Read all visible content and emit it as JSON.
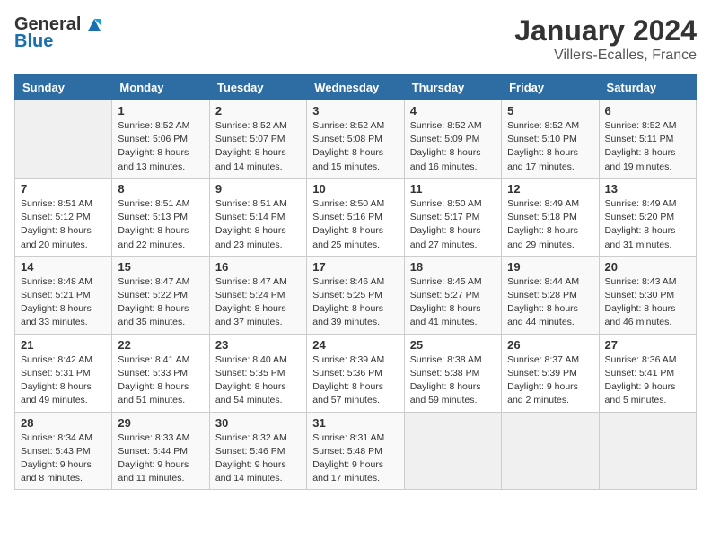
{
  "header": {
    "logo_general": "General",
    "logo_blue": "Blue",
    "month_year": "January 2024",
    "location": "Villers-Ecalles, France"
  },
  "days_of_week": [
    "Sunday",
    "Monday",
    "Tuesday",
    "Wednesday",
    "Thursday",
    "Friday",
    "Saturday"
  ],
  "weeks": [
    [
      {
        "day": "",
        "sunrise": "",
        "sunset": "",
        "daylight": ""
      },
      {
        "day": "1",
        "sunrise": "Sunrise: 8:52 AM",
        "sunset": "Sunset: 5:06 PM",
        "daylight": "Daylight: 8 hours and 13 minutes."
      },
      {
        "day": "2",
        "sunrise": "Sunrise: 8:52 AM",
        "sunset": "Sunset: 5:07 PM",
        "daylight": "Daylight: 8 hours and 14 minutes."
      },
      {
        "day": "3",
        "sunrise": "Sunrise: 8:52 AM",
        "sunset": "Sunset: 5:08 PM",
        "daylight": "Daylight: 8 hours and 15 minutes."
      },
      {
        "day": "4",
        "sunrise": "Sunrise: 8:52 AM",
        "sunset": "Sunset: 5:09 PM",
        "daylight": "Daylight: 8 hours and 16 minutes."
      },
      {
        "day": "5",
        "sunrise": "Sunrise: 8:52 AM",
        "sunset": "Sunset: 5:10 PM",
        "daylight": "Daylight: 8 hours and 17 minutes."
      },
      {
        "day": "6",
        "sunrise": "Sunrise: 8:52 AM",
        "sunset": "Sunset: 5:11 PM",
        "daylight": "Daylight: 8 hours and 19 minutes."
      }
    ],
    [
      {
        "day": "7",
        "sunrise": "Sunrise: 8:51 AM",
        "sunset": "Sunset: 5:12 PM",
        "daylight": "Daylight: 8 hours and 20 minutes."
      },
      {
        "day": "8",
        "sunrise": "Sunrise: 8:51 AM",
        "sunset": "Sunset: 5:13 PM",
        "daylight": "Daylight: 8 hours and 22 minutes."
      },
      {
        "day": "9",
        "sunrise": "Sunrise: 8:51 AM",
        "sunset": "Sunset: 5:14 PM",
        "daylight": "Daylight: 8 hours and 23 minutes."
      },
      {
        "day": "10",
        "sunrise": "Sunrise: 8:50 AM",
        "sunset": "Sunset: 5:16 PM",
        "daylight": "Daylight: 8 hours and 25 minutes."
      },
      {
        "day": "11",
        "sunrise": "Sunrise: 8:50 AM",
        "sunset": "Sunset: 5:17 PM",
        "daylight": "Daylight: 8 hours and 27 minutes."
      },
      {
        "day": "12",
        "sunrise": "Sunrise: 8:49 AM",
        "sunset": "Sunset: 5:18 PM",
        "daylight": "Daylight: 8 hours and 29 minutes."
      },
      {
        "day": "13",
        "sunrise": "Sunrise: 8:49 AM",
        "sunset": "Sunset: 5:20 PM",
        "daylight": "Daylight: 8 hours and 31 minutes."
      }
    ],
    [
      {
        "day": "14",
        "sunrise": "Sunrise: 8:48 AM",
        "sunset": "Sunset: 5:21 PM",
        "daylight": "Daylight: 8 hours and 33 minutes."
      },
      {
        "day": "15",
        "sunrise": "Sunrise: 8:47 AM",
        "sunset": "Sunset: 5:22 PM",
        "daylight": "Daylight: 8 hours and 35 minutes."
      },
      {
        "day": "16",
        "sunrise": "Sunrise: 8:47 AM",
        "sunset": "Sunset: 5:24 PM",
        "daylight": "Daylight: 8 hours and 37 minutes."
      },
      {
        "day": "17",
        "sunrise": "Sunrise: 8:46 AM",
        "sunset": "Sunset: 5:25 PM",
        "daylight": "Daylight: 8 hours and 39 minutes."
      },
      {
        "day": "18",
        "sunrise": "Sunrise: 8:45 AM",
        "sunset": "Sunset: 5:27 PM",
        "daylight": "Daylight: 8 hours and 41 minutes."
      },
      {
        "day": "19",
        "sunrise": "Sunrise: 8:44 AM",
        "sunset": "Sunset: 5:28 PM",
        "daylight": "Daylight: 8 hours and 44 minutes."
      },
      {
        "day": "20",
        "sunrise": "Sunrise: 8:43 AM",
        "sunset": "Sunset: 5:30 PM",
        "daylight": "Daylight: 8 hours and 46 minutes."
      }
    ],
    [
      {
        "day": "21",
        "sunrise": "Sunrise: 8:42 AM",
        "sunset": "Sunset: 5:31 PM",
        "daylight": "Daylight: 8 hours and 49 minutes."
      },
      {
        "day": "22",
        "sunrise": "Sunrise: 8:41 AM",
        "sunset": "Sunset: 5:33 PM",
        "daylight": "Daylight: 8 hours and 51 minutes."
      },
      {
        "day": "23",
        "sunrise": "Sunrise: 8:40 AM",
        "sunset": "Sunset: 5:35 PM",
        "daylight": "Daylight: 8 hours and 54 minutes."
      },
      {
        "day": "24",
        "sunrise": "Sunrise: 8:39 AM",
        "sunset": "Sunset: 5:36 PM",
        "daylight": "Daylight: 8 hours and 57 minutes."
      },
      {
        "day": "25",
        "sunrise": "Sunrise: 8:38 AM",
        "sunset": "Sunset: 5:38 PM",
        "daylight": "Daylight: 8 hours and 59 minutes."
      },
      {
        "day": "26",
        "sunrise": "Sunrise: 8:37 AM",
        "sunset": "Sunset: 5:39 PM",
        "daylight": "Daylight: 9 hours and 2 minutes."
      },
      {
        "day": "27",
        "sunrise": "Sunrise: 8:36 AM",
        "sunset": "Sunset: 5:41 PM",
        "daylight": "Daylight: 9 hours and 5 minutes."
      }
    ],
    [
      {
        "day": "28",
        "sunrise": "Sunrise: 8:34 AM",
        "sunset": "Sunset: 5:43 PM",
        "daylight": "Daylight: 9 hours and 8 minutes."
      },
      {
        "day": "29",
        "sunrise": "Sunrise: 8:33 AM",
        "sunset": "Sunset: 5:44 PM",
        "daylight": "Daylight: 9 hours and 11 minutes."
      },
      {
        "day": "30",
        "sunrise": "Sunrise: 8:32 AM",
        "sunset": "Sunset: 5:46 PM",
        "daylight": "Daylight: 9 hours and 14 minutes."
      },
      {
        "day": "31",
        "sunrise": "Sunrise: 8:31 AM",
        "sunset": "Sunset: 5:48 PM",
        "daylight": "Daylight: 9 hours and 17 minutes."
      },
      {
        "day": "",
        "sunrise": "",
        "sunset": "",
        "daylight": ""
      },
      {
        "day": "",
        "sunrise": "",
        "sunset": "",
        "daylight": ""
      },
      {
        "day": "",
        "sunrise": "",
        "sunset": "",
        "daylight": ""
      }
    ]
  ]
}
